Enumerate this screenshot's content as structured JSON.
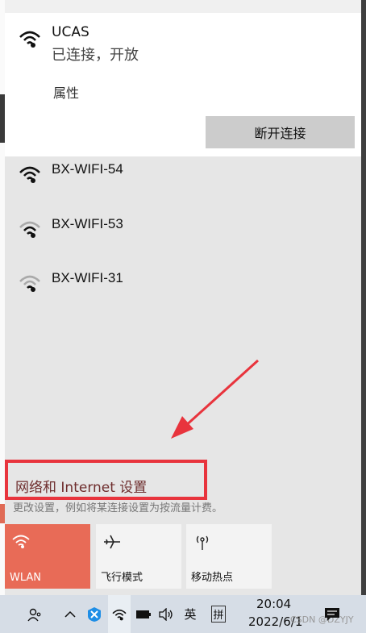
{
  "connected_network": {
    "name": "UCAS",
    "status": "已连接，开放",
    "properties_label": "属性",
    "disconnect_label": "断开连接"
  },
  "networks": [
    {
      "name": "BX-WIFI-54",
      "signal": "strong"
    },
    {
      "name": "BX-WIFI-53",
      "signal": "medium"
    },
    {
      "name": "BX-WIFI-31",
      "signal": "weak"
    }
  ],
  "settings": {
    "link_label": "网络和 Internet 设置",
    "description": "更改设置，例如将某连接设置为按流量计费。"
  },
  "quick_actions": [
    {
      "label": "WLAN",
      "active": true,
      "icon": "wifi-icon"
    },
    {
      "label": "飞行模式",
      "active": false,
      "icon": "airplane-icon"
    },
    {
      "label": "移动热点",
      "active": false,
      "icon": "hotspot-icon"
    }
  ],
  "taskbar": {
    "ime_lang": "英",
    "ime_mode": "拼",
    "time": "20:04",
    "date": "2022/6/1",
    "watermark": "CSDN @DZYJY"
  },
  "colors": {
    "accent": "#e86b57",
    "highlight_box": "#e8343d"
  }
}
